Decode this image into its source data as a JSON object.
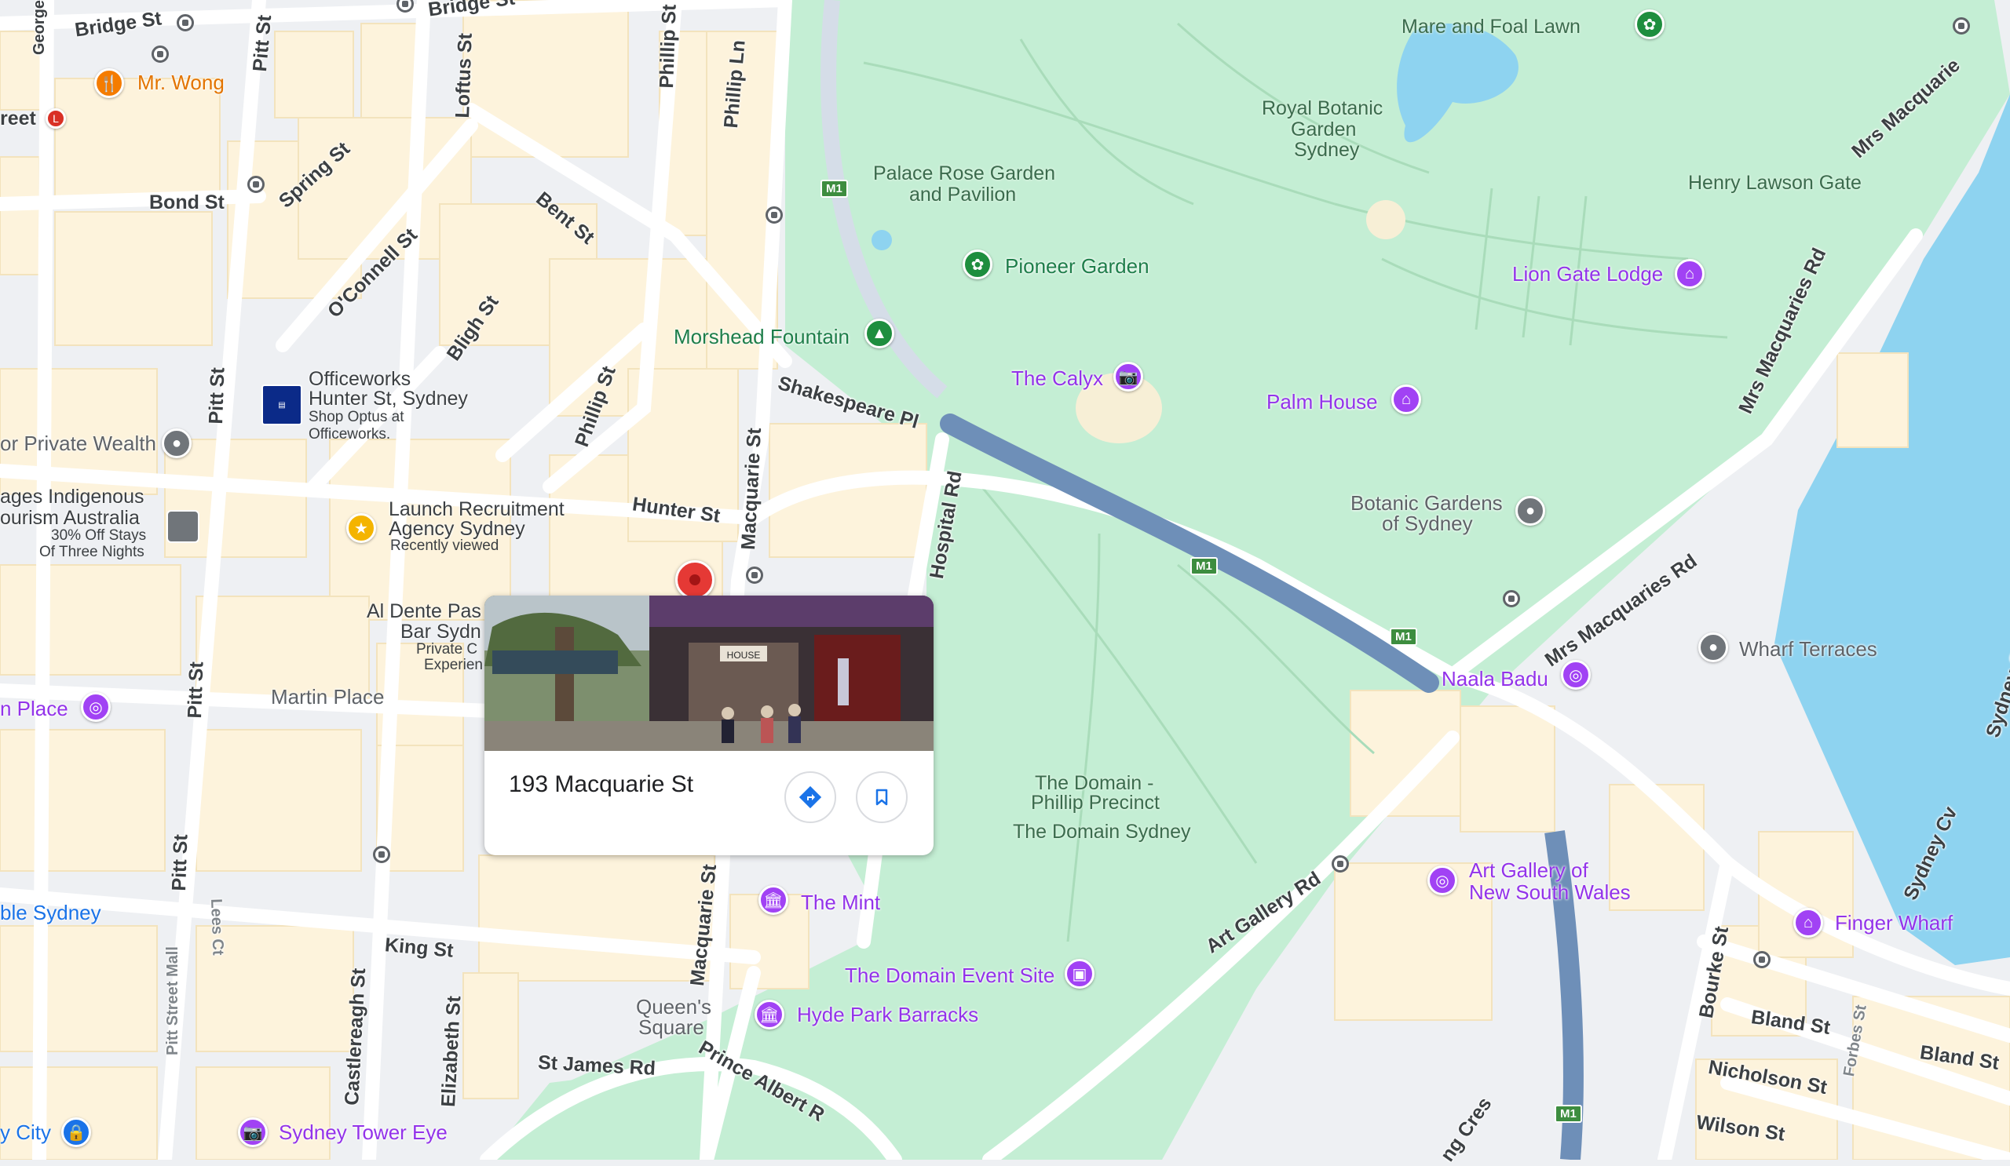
{
  "streets": {
    "bridge_st": "Bridge St",
    "bridge_st2": "Bridge St",
    "george_st": "George St",
    "pitt_st1": "Pitt St",
    "pitt_st2": "Pitt St",
    "pitt_st3": "Pitt St",
    "pitt_st4": "Pitt St",
    "loftus_st": "Loftus St",
    "phillip_st1": "Phillip St",
    "phillip_st2": "Phillip St",
    "phillip_ln": "Phillip Ln",
    "bond_st": "Bond St",
    "spring_st": "Spring St",
    "bent_st": "Bent St",
    "oconnell_st": "O'Connell St",
    "bligh_st": "Bligh St",
    "hunter_st": "Hunter St",
    "macquarie_st1": "Macquarie St",
    "macquarie_st2": "Macquarie St",
    "shakespeare_pl": "Shakespeare Pl",
    "hospital_rd": "Hospital Rd",
    "martin_place": "Martin Place",
    "king_st": "King St",
    "lees_ct": "Lees Ct",
    "castlereagh_st": "Castlereagh St",
    "elizabeth_st": "Elizabeth St",
    "pitt_street_mall": "Pitt Street Mall",
    "st_james_rd": "St James Rd",
    "prince_albert_rd": "Prince Albert R",
    "art_gallery_rd": "Art Gallery Rd",
    "mrs_macquaries_rd1": "Mrs Macquaries Rd",
    "mrs_macquaries_rd2": "Mrs Macquaries Rd",
    "mrs_macquarie_top": "Mrs Macquarie",
    "bourke_st": "Bourke St",
    "bland_st1": "Bland St",
    "bland_st2": "Bland St",
    "nicholson_st": "Nicholson St",
    "wilson_st": "Wilson St",
    "forbes_st": "Forbes St",
    "sydney_cv": "Sydney Cv",
    "sydney_c": "Sydney C",
    "cres": "ng Cres",
    "street_partial": "reet"
  },
  "places": {
    "mr_wong": "Mr. Wong",
    "officeworks_name": "Officeworks",
    "officeworks_loc": "Hunter St, Sydney",
    "officeworks_sub1": "Shop Optus at",
    "officeworks_sub2": "Officeworks.",
    "private_wealth": "or Private Wealth",
    "indigenous1": "ages Indigenous",
    "indigenous2": "ourism Australia",
    "indigenous_sub1": "30% Off Stays",
    "indigenous_sub2": "Of Three Nights",
    "launch1": "Launch Recruitment",
    "launch2": "Agency Sydney",
    "launch_sub": "Recently viewed",
    "al_dente1": "Al Dente Pas",
    "al_dente2": "Bar Sydn",
    "al_dente_sub1": "Private C",
    "al_dente_sub2": "Experien",
    "n_place": "n Place",
    "ble_sydney": "ble Sydney",
    "y_city": "y City",
    "sydney_tower_eye": "Sydney Tower Eye",
    "queens_square1": "Queen's",
    "queens_square2": "Square",
    "hyde_park_barracks": "Hyde Park Barracks",
    "the_mint": "The Mint",
    "domain_event_site": "The Domain Event Site",
    "domain_phillip1": "The Domain -",
    "domain_phillip2": "Phillip Precinct",
    "domain_sydney": "The Domain Sydney",
    "mare_foal": "Mare and Foal Lawn",
    "rbg1": "Royal Botanic",
    "rbg2": "Garden",
    "rbg3": "Sydney",
    "palace_rose1": "Palace Rose Garden",
    "palace_rose2": "and Pavilion",
    "pioneer_garden": "Pioneer Garden",
    "morshead_fountain": "Morshead Fountain",
    "the_calyx": "The Calyx",
    "palm_house": "Palm House",
    "henry_lawson_gate": "Henry Lawson Gate",
    "lion_gate_lodge": "Lion Gate Lodge",
    "botanic_gardens1": "Botanic Gardens",
    "botanic_gardens2": "of Sydney",
    "wharf_terraces": "Wharf Terraces",
    "naala_badu": "Naala Badu",
    "art_gallery1": "Art Gallery of",
    "art_gallery2": "New South Wales",
    "finger_wharf": "Finger Wharf"
  },
  "route_shields": [
    "M1",
    "M1",
    "M1",
    "M1"
  ],
  "info_card": {
    "title": "193 Macquarie St",
    "photo_sign": "HOUSE"
  },
  "colors": {
    "land": "#eef0f3",
    "buildings": "#fdf3dc",
    "park": "#c4eed4",
    "water": "#8ed3f0",
    "motorway": "#6e8fb8",
    "selected_pin": "#e53935",
    "poi_purple": "#9333ea",
    "poi_green": "#1e8e3e"
  }
}
